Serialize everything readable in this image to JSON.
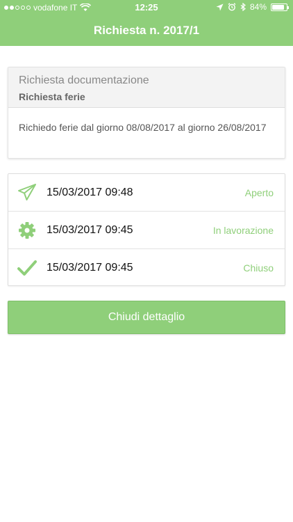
{
  "status_bar": {
    "carrier": "vodafone IT",
    "time": "12:25",
    "battery": "84%",
    "battery_level": 0.84
  },
  "header": {
    "title": "Richiesta n. 2017/1"
  },
  "request": {
    "category": "Richiesta documentazione",
    "subject": "Richiesta ferie",
    "body": "Richiedo ferie dal giorno 08/08/2017 al giorno 26/08/2017"
  },
  "history": [
    {
      "icon": "paper-plane-icon",
      "datetime": "15/03/2017 09:48",
      "status": "Aperto"
    },
    {
      "icon": "gear-icon",
      "datetime": "15/03/2017 09:45",
      "status": "In lavorazione"
    },
    {
      "icon": "checkmark-icon",
      "datetime": "15/03/2017 09:45",
      "status": "Chiuso"
    }
  ],
  "actions": {
    "close_label": "Chiudi dettaglio"
  },
  "colors": {
    "accent": "#8fcf7a"
  }
}
